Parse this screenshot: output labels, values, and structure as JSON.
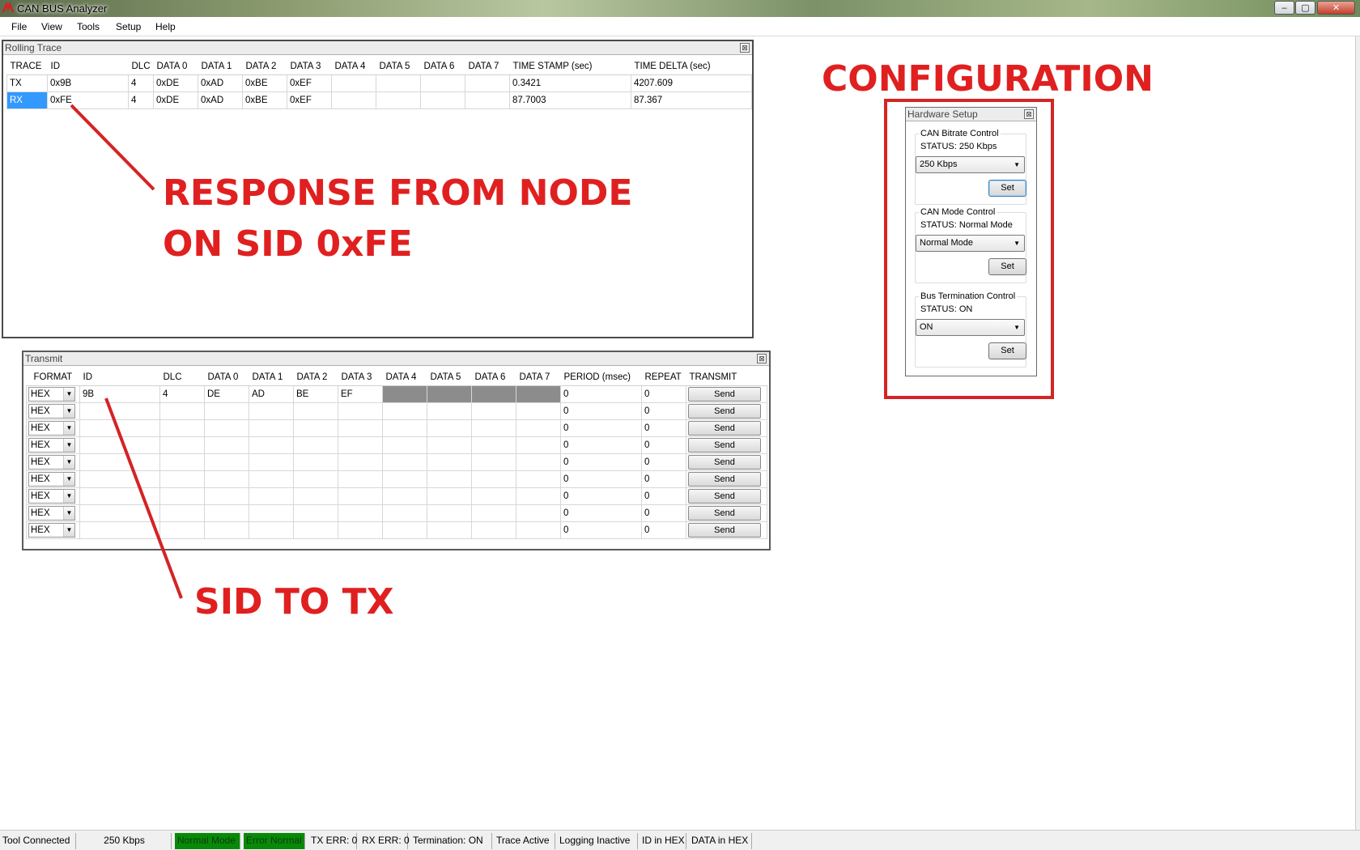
{
  "window": {
    "title": "CAN BUS Analyzer",
    "controls": {
      "minimize": "–",
      "restore": "▢",
      "close": "✕"
    }
  },
  "menu": [
    "File",
    "View",
    "Tools",
    "Setup",
    "Help"
  ],
  "rolling_trace": {
    "title": "Rolling Trace",
    "columns": [
      "TRACE",
      "ID",
      "DLC",
      "DATA 0",
      "DATA 1",
      "DATA 2",
      "DATA 3",
      "DATA 4",
      "DATA 5",
      "DATA 6",
      "DATA 7",
      "TIME STAMP (sec)",
      "TIME DELTA (sec)"
    ],
    "rows": [
      [
        "TX",
        "0x9B",
        "4",
        "0xDE",
        "0xAD",
        "0xBE",
        "0xEF",
        "",
        "",
        "",
        "",
        "0.3421",
        "4207.609"
      ],
      [
        "RX",
        "0xFE",
        "4",
        "0xDE",
        "0xAD",
        "0xBE",
        "0xEF",
        "",
        "",
        "",
        "",
        "87.7003",
        "87.367"
      ]
    ]
  },
  "transmit": {
    "title": "Transmit",
    "columns": [
      "FORMAT",
      "ID",
      "DLC",
      "DATA 0",
      "DATA 1",
      "DATA 2",
      "DATA 3",
      "DATA 4",
      "DATA 5",
      "DATA 6",
      "DATA 7",
      "PERIOD (msec)",
      "REPEAT",
      "TRANSMIT"
    ],
    "rows": [
      {
        "format": "HEX",
        "id": "9B",
        "dlc": "4",
        "data": [
          "DE",
          "AD",
          "BE",
          "EF",
          "",
          "",
          "",
          ""
        ],
        "period": "0",
        "repeat": "0",
        "button": "Send"
      },
      {
        "format": "HEX",
        "id": "",
        "dlc": "",
        "data": [
          "",
          "",
          "",
          "",
          "",
          "",
          "",
          ""
        ],
        "period": "0",
        "repeat": "0",
        "button": "Send"
      },
      {
        "format": "HEX",
        "id": "",
        "dlc": "",
        "data": [
          "",
          "",
          "",
          "",
          "",
          "",
          "",
          ""
        ],
        "period": "0",
        "repeat": "0",
        "button": "Send"
      },
      {
        "format": "HEX",
        "id": "",
        "dlc": "",
        "data": [
          "",
          "",
          "",
          "",
          "",
          "",
          "",
          ""
        ],
        "period": "0",
        "repeat": "0",
        "button": "Send"
      },
      {
        "format": "HEX",
        "id": "",
        "dlc": "",
        "data": [
          "",
          "",
          "",
          "",
          "",
          "",
          "",
          ""
        ],
        "period": "0",
        "repeat": "0",
        "button": "Send"
      },
      {
        "format": "HEX",
        "id": "",
        "dlc": "",
        "data": [
          "",
          "",
          "",
          "",
          "",
          "",
          "",
          ""
        ],
        "period": "0",
        "repeat": "0",
        "button": "Send"
      },
      {
        "format": "HEX",
        "id": "",
        "dlc": "",
        "data": [
          "",
          "",
          "",
          "",
          "",
          "",
          "",
          ""
        ],
        "period": "0",
        "repeat": "0",
        "button": "Send"
      },
      {
        "format": "HEX",
        "id": "",
        "dlc": "",
        "data": [
          "",
          "",
          "",
          "",
          "",
          "",
          "",
          ""
        ],
        "period": "0",
        "repeat": "0",
        "button": "Send"
      },
      {
        "format": "HEX",
        "id": "",
        "dlc": "",
        "data": [
          "",
          "",
          "",
          "",
          "",
          "",
          "",
          ""
        ],
        "period": "0",
        "repeat": "0",
        "button": "Send"
      }
    ]
  },
  "hardware_setup": {
    "title": "Hardware Setup",
    "bitrate": {
      "label": "CAN Bitrate Control",
      "status": "STATUS: 250 Kbps",
      "selected": "250 Kbps",
      "button": "Set"
    },
    "mode": {
      "label": "CAN Mode Control",
      "status": "STATUS: Normal Mode",
      "selected": "Normal Mode",
      "button": "Set"
    },
    "termination": {
      "label": "Bus Termination Control",
      "status": "STATUS: ON",
      "selected": "ON",
      "button": "Set"
    }
  },
  "annotations": {
    "configuration": "CONFIGURATION",
    "response_line1": "RESPONSE FROM NODE",
    "response_line2": "ON SID 0xFE",
    "sid_to_tx": "SID TO TX",
    "color": "#e02020"
  },
  "status_bar": [
    "Tool Connected",
    "250 Kbps",
    "Normal Mode",
    "Error Normal",
    "TX ERR: 0",
    "RX ERR: 0",
    "Termination: ON",
    "Trace Active",
    "Logging Inactive",
    "ID in HEX",
    "DATA in HEX"
  ],
  "colors": {
    "status_ok": "#088a08",
    "selection": "#3399ff",
    "annotation": "#e02020"
  }
}
